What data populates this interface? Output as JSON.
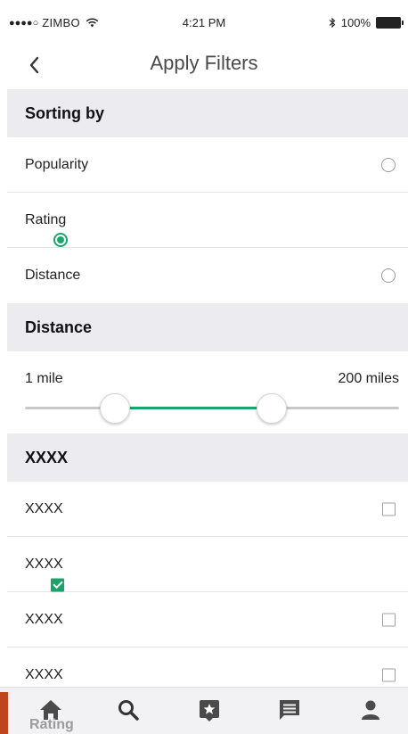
{
  "status_bar": {
    "signal": "●●●●○",
    "carrier": "ZIMBO",
    "time": "4:21 PM",
    "battery": "100%"
  },
  "nav": {
    "title": "Apply Filters"
  },
  "sorting": {
    "header": "Sorting by",
    "options": [
      {
        "label": "Popularity",
        "selected": false
      },
      {
        "label": "Rating",
        "selected": true
      },
      {
        "label": "Distance",
        "selected": false
      }
    ]
  },
  "distance": {
    "header": "Distance",
    "min_label": "1 mile",
    "max_label": "200 miles",
    "range_low_fraction": 0.24,
    "range_high_fraction": 0.66
  },
  "xxxx": {
    "header": "XXXX",
    "items": [
      {
        "label": "XXXX",
        "checked": false
      },
      {
        "label": "XXXX",
        "checked": true
      },
      {
        "label": "XXXX",
        "checked": false
      },
      {
        "label": "XXXX",
        "checked": false
      }
    ]
  },
  "behind_text": "Rating",
  "colors": {
    "accent": "#1aa56a",
    "section_bg": "#ebebf0",
    "tab_icon": "#4a4a4a"
  },
  "tabs": [
    {
      "icon": "home-icon"
    },
    {
      "icon": "search-icon"
    },
    {
      "icon": "favorite-icon"
    },
    {
      "icon": "messages-icon"
    },
    {
      "icon": "profile-icon"
    }
  ]
}
